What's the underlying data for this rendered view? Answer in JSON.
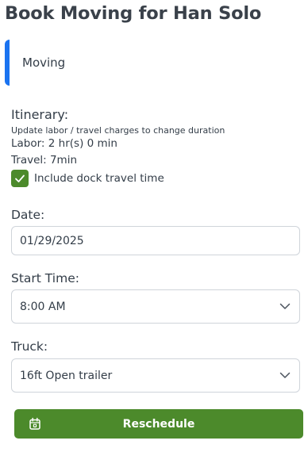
{
  "page": {
    "title": "Book Moving for Han Solo"
  },
  "service": {
    "name": "Moving",
    "accent_color": "#1a73f0"
  },
  "itinerary": {
    "heading": "Itinerary:",
    "hint": "Update labor / travel charges to change duration",
    "labor": "Labor: 2 hr(s) 0 min",
    "travel": "Travel: 7min",
    "dock_travel": {
      "label": "Include dock travel time",
      "checked": true,
      "icon": "check-icon"
    }
  },
  "date": {
    "label": "Date:",
    "value": "01/29/2025"
  },
  "start_time": {
    "label": "Start Time:",
    "value": "8:00 AM",
    "icon": "chevron-down-icon"
  },
  "truck": {
    "label": "Truck:",
    "value": "16ft Open trailer",
    "icon": "chevron-down-icon"
  },
  "actions": {
    "reschedule_label": "Reschedule",
    "reschedule_icon": "calendar-icon",
    "button_color": "#4c8a2b"
  }
}
